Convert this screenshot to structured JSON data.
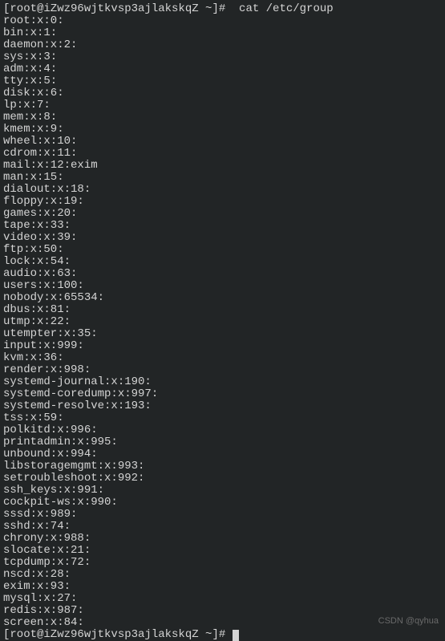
{
  "prompt1": "[root@iZwz96wjtkvsp3ajlakskqZ ~]#  cat /etc/group",
  "lines": [
    "root:x:0:",
    "bin:x:1:",
    "daemon:x:2:",
    "sys:x:3:",
    "adm:x:4:",
    "tty:x:5:",
    "disk:x:6:",
    "lp:x:7:",
    "mem:x:8:",
    "kmem:x:9:",
    "wheel:x:10:",
    "cdrom:x:11:",
    "mail:x:12:exim",
    "man:x:15:",
    "dialout:x:18:",
    "floppy:x:19:",
    "games:x:20:",
    "tape:x:33:",
    "video:x:39:",
    "ftp:x:50:",
    "lock:x:54:",
    "audio:x:63:",
    "users:x:100:",
    "nobody:x:65534:",
    "dbus:x:81:",
    "utmp:x:22:",
    "utempter:x:35:",
    "input:x:999:",
    "kvm:x:36:",
    "render:x:998:",
    "systemd-journal:x:190:",
    "systemd-coredump:x:997:",
    "systemd-resolve:x:193:",
    "tss:x:59:",
    "polkitd:x:996:",
    "printadmin:x:995:",
    "unbound:x:994:",
    "libstoragemgmt:x:993:",
    "setroubleshoot:x:992:",
    "ssh_keys:x:991:",
    "cockpit-ws:x:990:",
    "sssd:x:989:",
    "sshd:x:74:",
    "chrony:x:988:",
    "slocate:x:21:",
    "tcpdump:x:72:",
    "nscd:x:28:",
    "exim:x:93:",
    "mysql:x:27:",
    "redis:x:987:",
    "screen:x:84:"
  ],
  "prompt2": "[root@iZwz96wjtkvsp3ajlakskqZ ~]# ",
  "watermark": "CSDN @qyhua"
}
